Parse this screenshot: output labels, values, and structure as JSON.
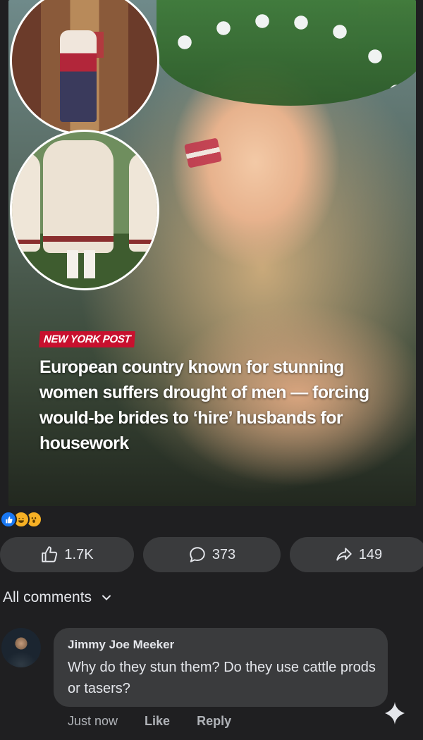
{
  "post": {
    "source": "NEW YORK POST",
    "headline": "European country known for stunning women suffers drought of men — forcing would-be brides to ‘hire’ husbands for housework"
  },
  "reactions": {
    "icons": [
      "like-icon",
      "haha-icon",
      "wow-icon"
    ]
  },
  "actions": {
    "like_count": "1.7K",
    "comment_count": "373",
    "share_count": "149"
  },
  "comments": {
    "filter_label": "All comments",
    "items": [
      {
        "author": "Jimmy Joe Meeker",
        "text": "Why do they stun them? Do they use cattle prods or tasers?",
        "time": "Just now",
        "like_label": "Like",
        "reply_label": "Reply"
      }
    ]
  },
  "colors": {
    "background": "#1f1f21",
    "button_bg": "#3a3b3d",
    "source_tag": "#c8102e",
    "like_blue": "#1877f2"
  }
}
